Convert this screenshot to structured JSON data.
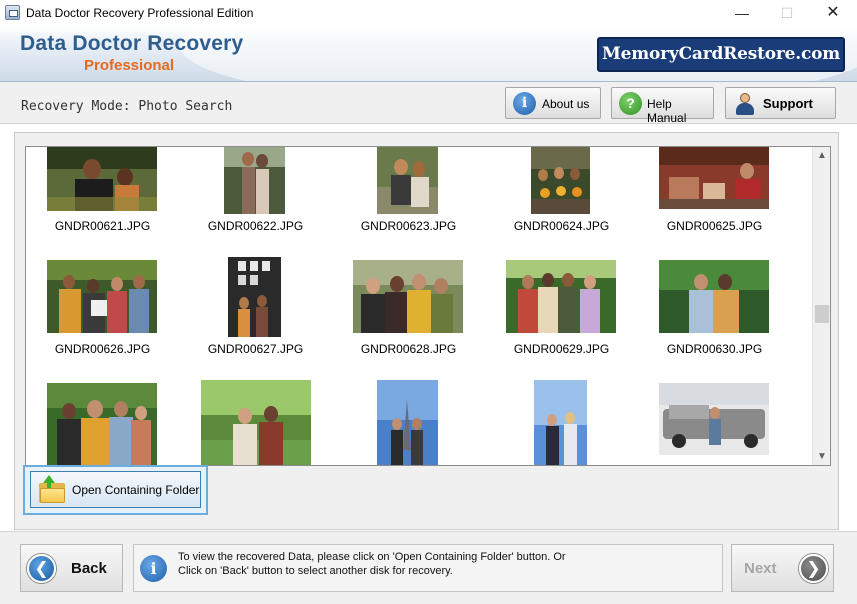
{
  "window": {
    "title": "Data Doctor Recovery Professional Edition",
    "controls": {
      "minimize": "—",
      "maximize": "☐",
      "close": "✕"
    }
  },
  "header": {
    "brand_title": "Data Doctor Recovery",
    "brand_edition": "Professional",
    "site_badge": "MemoryCardRestore.com"
  },
  "toolbar": {
    "mode_label": "Recovery Mode: Photo Search",
    "about_label": "About us",
    "help_label": "Help Manual",
    "support_label": "Support",
    "about_icon": "info-icon",
    "help_icon": "question-icon",
    "support_icon": "support-person-icon"
  },
  "gallery": {
    "photos": [
      {
        "filename": "GNDR00621.JPG"
      },
      {
        "filename": "GNDR00622.JPG"
      },
      {
        "filename": "GNDR00623.JPG"
      },
      {
        "filename": "GNDR00624.JPG"
      },
      {
        "filename": "GNDR00625.JPG"
      },
      {
        "filename": "GNDR00626.JPG"
      },
      {
        "filename": "GNDR00627.JPG"
      },
      {
        "filename": "GNDR00628.JPG"
      },
      {
        "filename": "GNDR00629.JPG"
      },
      {
        "filename": "GNDR00630.JPG"
      },
      {
        "filename": ""
      },
      {
        "filename": ""
      },
      {
        "filename": ""
      },
      {
        "filename": ""
      },
      {
        "filename": ""
      }
    ]
  },
  "actions": {
    "open_folder_label": "Open Containing Folder",
    "open_folder_icon": "folder-open-icon"
  },
  "footer": {
    "back_label": "Back",
    "next_label": "Next",
    "info_text_line1": "To view the recovered Data, please click on 'Open Containing Folder' button. Or",
    "info_text_line2": "Click on 'Back' button to select another disk for recovery."
  },
  "colors": {
    "brand_blue": "#2e5e8e",
    "brand_orange": "#e56b1f",
    "badge_navy": "#1a3d7a",
    "selection_blue": "#6aaee0"
  }
}
